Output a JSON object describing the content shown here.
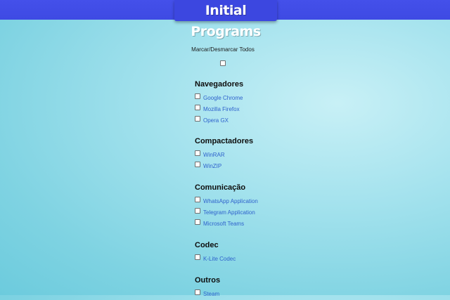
{
  "app": {
    "title": "Initial Programs"
  },
  "toggle_all": {
    "label": "Marcar/Desmarcar Todos",
    "checked": false
  },
  "sections": [
    {
      "title": "Navegadores",
      "items": [
        {
          "label": "Google Chrome",
          "checked": false
        },
        {
          "label": "Mozilla Firefox",
          "checked": false
        },
        {
          "label": "Opera GX",
          "checked": false
        }
      ]
    },
    {
      "title": "Compactadores",
      "items": [
        {
          "label": "WinRAR",
          "checked": false
        },
        {
          "label": "WinZIP",
          "checked": false
        }
      ]
    },
    {
      "title": "Comunicação",
      "items": [
        {
          "label": "WhatsApp Application",
          "checked": false
        },
        {
          "label": "Telegram Application",
          "checked": false
        },
        {
          "label": "Microsoft Teams",
          "checked": false
        }
      ]
    },
    {
      "title": "Codec",
      "items": [
        {
          "label": "K-Lite Codec",
          "checked": false
        }
      ]
    },
    {
      "title": "Outros",
      "items": [
        {
          "label": "Steam",
          "checked": false
        }
      ]
    }
  ]
}
